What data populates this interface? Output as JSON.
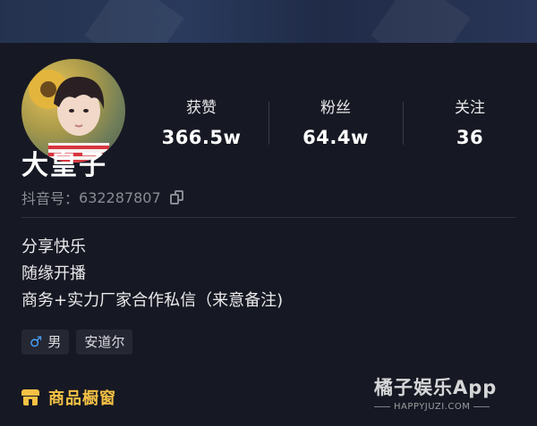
{
  "profile": {
    "stats": [
      {
        "label": "获赞",
        "value": "366.5w"
      },
      {
        "label": "粉丝",
        "value": "64.4w"
      },
      {
        "label": "关注",
        "value": "36"
      }
    ],
    "name": "大皇子",
    "douyin_id_label": "抖音号：",
    "douyin_id": "632287807",
    "bio": [
      "分享快乐",
      "随缘开播",
      "商务+实力厂家合作私信（来意备注)"
    ],
    "tags": {
      "gender_symbol": "♂",
      "gender": "男",
      "location": "安道尔"
    },
    "shop_label": "商品橱窗"
  },
  "watermark": {
    "title": "橘子娱乐App",
    "sub": "HAPPYJUZI.COM"
  },
  "colors": {
    "background": "#161823",
    "accent": "#f5c144",
    "male": "#4aa3ff"
  }
}
